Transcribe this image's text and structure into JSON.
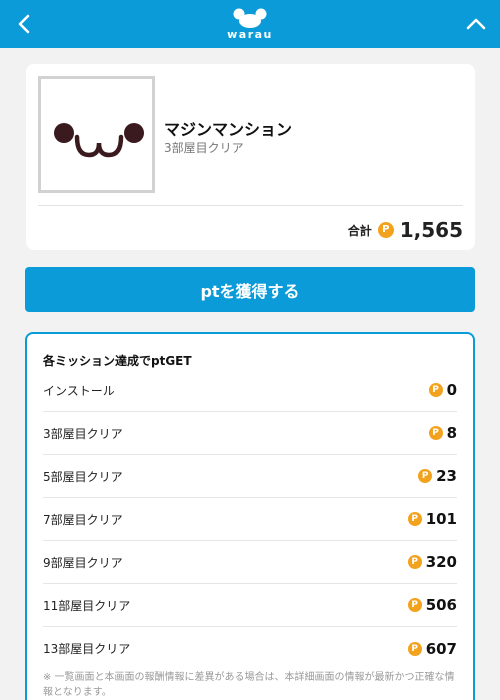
{
  "header": {
    "back_icon": "chevron-left-icon",
    "logo_text": "warau",
    "collapse_icon": "chevron-up-icon",
    "bg_color": "#0b9bd8"
  },
  "app": {
    "name": "マジンマンション",
    "status": "3部屋目クリア",
    "total_label": "合計",
    "coin_symbol": "P",
    "total_value": "1,565"
  },
  "get_button": {
    "label": "ptを獲得する"
  },
  "missions": {
    "title": "各ミッション達成でptGET",
    "coin_symbol": "P",
    "items": [
      {
        "label": "インストール",
        "value": "0"
      },
      {
        "label": "3部屋目クリア",
        "value": "8"
      },
      {
        "label": "5部屋目クリア",
        "value": "23"
      },
      {
        "label": "7部屋目クリア",
        "value": "101"
      },
      {
        "label": "9部屋目クリア",
        "value": "320"
      },
      {
        "label": "11部屋目クリア",
        "value": "506"
      },
      {
        "label": "13部屋目クリア",
        "value": "607"
      }
    ],
    "note": "※ 一覧画面と本画面の報酬情報に差異がある場合は、本詳細画面の情報が最新かつ正確な情報となります。"
  },
  "colors": {
    "accent": "#0b9bd8",
    "coin": "#f3a21e",
    "background": "#f2f2f2"
  }
}
